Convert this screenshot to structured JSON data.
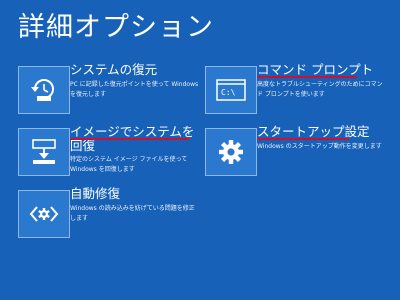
{
  "header": {
    "title": "詳細オプション"
  },
  "options": [
    {
      "title": "システムの復元",
      "description": "PC に記録した復元ポイントを使って Windows を復元します",
      "icon": "system-restore-icon"
    },
    {
      "title": "コマンド プロンプト",
      "description": "高度なトラブルシューティングのためにコマンド プロンプトを使います",
      "icon": "command-prompt-icon"
    },
    {
      "title": "イメージでシステムを回復",
      "description": "特定のシステム イメージ ファイルを使って Windows を回復します",
      "icon": "system-image-recovery-icon"
    },
    {
      "title": "スタートアップ設定",
      "description": "Windows のスタートアップ動作を変更します",
      "icon": "gear-icon"
    },
    {
      "title": "自動修復",
      "description": "Windows の読み込みを妨げている問題を修正します",
      "icon": "automatic-repair-icon"
    }
  ],
  "icon_text": {
    "cmd": "C:\\"
  },
  "colors": {
    "background": "#1762b8",
    "tile": "#2b79cf",
    "annotation": "#d0102a"
  }
}
